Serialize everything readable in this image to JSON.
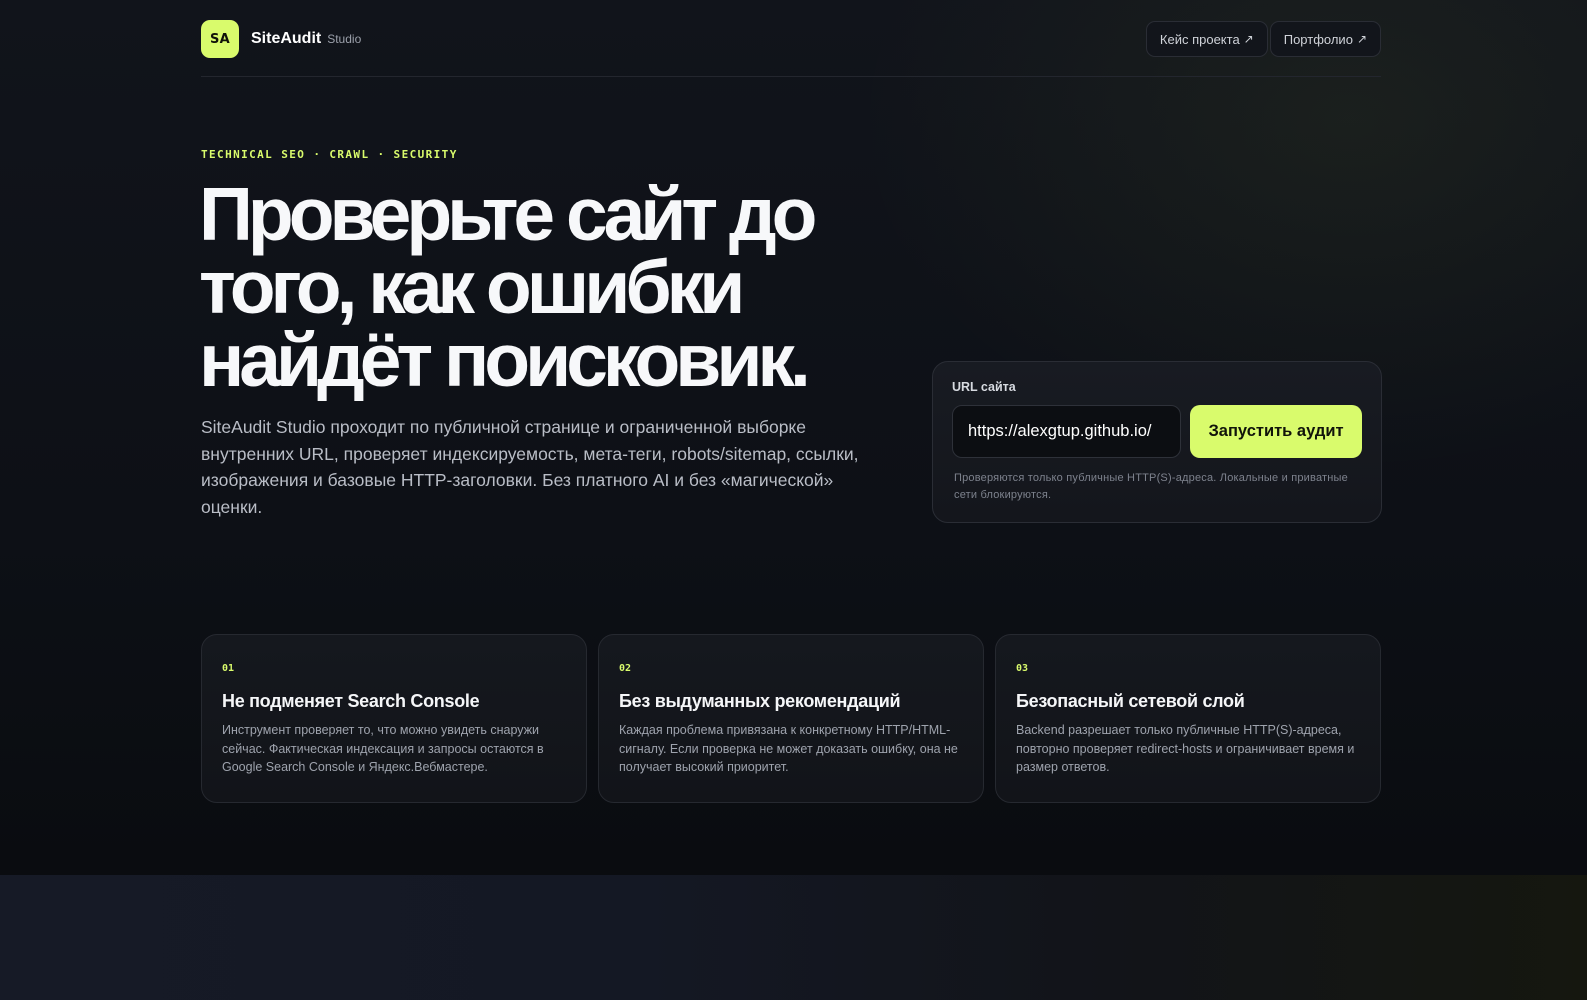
{
  "header": {
    "logo_text": "SA",
    "brand_name": "SiteAudit",
    "brand_sub": "Studio",
    "nav": [
      {
        "label": "Кейс проекта",
        "icon": "arrow-up-right-icon"
      },
      {
        "label": "Портфолио",
        "icon": "arrow-up-right-icon"
      }
    ]
  },
  "hero": {
    "eyebrow": "TECHNICAL SEO · CRAWL · SECURITY",
    "headline": "Проверьте сайт до того, как ошибки найдёт поисковик.",
    "lead": "SiteAudit Studio проходит по публичной странице и ограниченной выборке внутренних URL, проверяет индексируемость, мета-теги, robots/sitemap, ссылки, изображения и базовые HTTP-заголовки. Без платного AI и без «магической» оценки."
  },
  "form": {
    "label": "URL сайта",
    "url_value": "https://alexgtup.github.io/",
    "button_label": "Запустить аудит",
    "note": "Проверяются только публичные HTTP(S)-адреса. Локальные и приватные сети блокируются."
  },
  "features": [
    {
      "num": "01",
      "title": "Не подменяет Search Console",
      "text": "Инструмент проверяет то, что можно увидеть снаружи сейчас. Фактическая индексация и запросы остаются в Google Search Console и Яндекс.Вебмастере."
    },
    {
      "num": "02",
      "title": "Без выдуманных рекомендаций",
      "text": "Каждая проблема привязана к конкретному HTTP/HTML-сигналу. Если проверка не может доказать ошибку, она не получает высокий приоритет."
    },
    {
      "num": "03",
      "title": "Безопасный сетевой слой",
      "text": "Backend разрешает только публичные HTTP(S)-адреса, повторно проверяет redirect-hosts и ограничивает время и размер ответов."
    }
  ],
  "colors": {
    "accent": "#d9fb6c",
    "background": "#0c0e13"
  }
}
